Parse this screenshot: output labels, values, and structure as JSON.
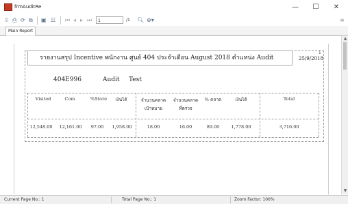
{
  "window": {
    "title": "frmAuditRe",
    "minimize": "—",
    "maximize": "☐",
    "close": "✕"
  },
  "toolbar": {
    "page_input": "1",
    "page_total": "/1",
    "icons": [
      "export-icon",
      "print-icon",
      "refresh-icon",
      "copy-icon",
      "toggle-group-tree-icon",
      "group-tree-icon",
      "first-page-icon",
      "previous-page-icon",
      "next-page-icon",
      "last-page-icon",
      "find-icon",
      "zoom-icon"
    ]
  },
  "tabs": [
    "Main Report"
  ],
  "report": {
    "title": "รายงานสรุป Incentive พนักงาน ศูนย์ 404 ประจำเดือน August 2018 ตำแหน่ง Audit",
    "page_number": "1",
    "date": "25/9/2018",
    "employee_code": "404E996",
    "employee_first": "Audit",
    "employee_last": "Test",
    "columns": [
      "Visited",
      "Com",
      "%Store",
      "เงินได้",
      "จำนวนคลาด เป้าหมาย",
      "จำนวนคลาด ที่ตรวจ",
      "% คลาด",
      "เงินได้",
      "Total"
    ],
    "rows": [
      [
        "12,548.00",
        "12,161.00",
        "97.00",
        "1,958.00",
        "18.00",
        "16.00",
        "89.00",
        "1,778.00",
        "3,716.00"
      ]
    ]
  },
  "status": {
    "current_page": "Current Page No.: 1",
    "total_page": "Total Page No.: 1",
    "zoom": "Zoom Factor: 100%"
  },
  "colors": {
    "app_icon": "#c23b22",
    "toolbar_icon": "#5a6e8a"
  }
}
